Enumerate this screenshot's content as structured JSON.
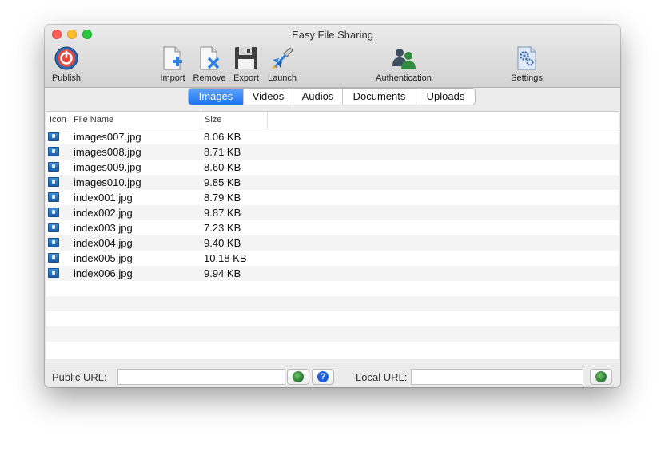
{
  "window": {
    "title": "Easy File Sharing"
  },
  "toolbar": {
    "publish": "Publish",
    "import": "Import",
    "remove": "Remove",
    "export": "Export",
    "launch": "Launch",
    "authentication": "Authentication",
    "settings": "Settings",
    "icons": {
      "publish": "power-icon",
      "import": "document-add-icon",
      "remove": "document-remove-icon",
      "export": "floppy-disk-icon",
      "launch": "rocket-icon",
      "authentication": "users-icon",
      "settings": "gear-document-icon"
    }
  },
  "tabs": [
    "Images",
    "Videos",
    "Audios",
    "Documents",
    "Uploads"
  ],
  "active_tab": "Images",
  "table": {
    "columns": [
      "Icon",
      "File Name",
      "Size"
    ],
    "rows": [
      {
        "name": "images007.jpg",
        "size": "8.06 KB"
      },
      {
        "name": "images008.jpg",
        "size": "8.71 KB"
      },
      {
        "name": "images009.jpg",
        "size": "8.60 KB"
      },
      {
        "name": "images010.jpg",
        "size": "9.85 KB"
      },
      {
        "name": "index001.jpg",
        "size": "8.79 KB"
      },
      {
        "name": "index002.jpg",
        "size": "9.87 KB"
      },
      {
        "name": "index003.jpg",
        "size": "7.23 KB"
      },
      {
        "name": "index004.jpg",
        "size": "9.40 KB"
      },
      {
        "name": "index005.jpg",
        "size": "10.18 KB"
      },
      {
        "name": "index006.jpg",
        "size": "9.94 KB"
      }
    ]
  },
  "footer": {
    "public_url_label": "Public URL:",
    "public_url_value": "",
    "local_url_label": "Local URL:",
    "local_url_value": "",
    "help_symbol": "?"
  },
  "colors": {
    "accent": "#1f73ef",
    "row_alt": "#f4f4f4",
    "close": "#fc5f57",
    "minimize": "#fdbc2e",
    "maximize": "#29c840"
  }
}
